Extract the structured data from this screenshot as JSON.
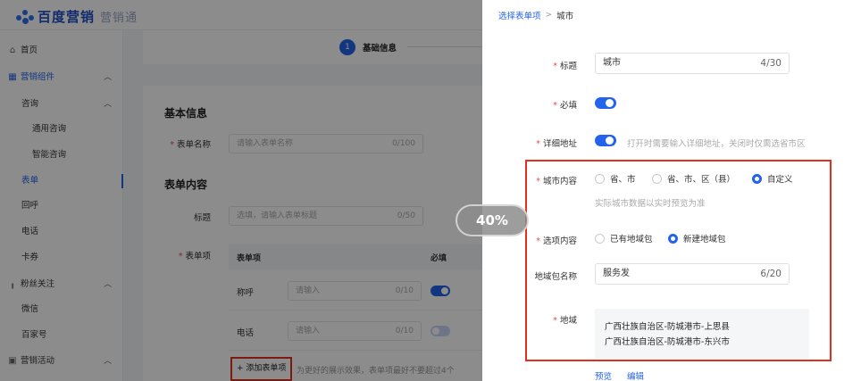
{
  "app": {
    "logo_main": "百度营销",
    "logo_sub": "营销通"
  },
  "sidebar": {
    "items": [
      {
        "label": "首页",
        "icon": "home-icon"
      },
      {
        "label": "营销组件",
        "icon": "grid-icon"
      },
      {
        "label": "咨询"
      },
      {
        "label": "通用咨询"
      },
      {
        "label": "智能咨询"
      },
      {
        "label": "表单"
      },
      {
        "label": "回呼"
      },
      {
        "label": "电话"
      },
      {
        "label": "卡券"
      },
      {
        "label": "粉丝关注",
        "icon": "bar-chart-icon"
      },
      {
        "label": "微信"
      },
      {
        "label": "百家号"
      },
      {
        "label": "营销活动",
        "icon": "calendar-icon"
      }
    ]
  },
  "steps": {
    "num": "1",
    "label": "基础信息"
  },
  "form": {
    "basic_title": "基本信息",
    "name_label": "表单名称",
    "name_placeholder": "请输入表单名称",
    "name_count": "0/100",
    "content_title": "表单内容",
    "heading_label": "标题",
    "heading_placeholder": "选填，请输入表单标题",
    "heading_count": "0/50",
    "items_label": "表单项",
    "table_head_item": "表单项",
    "table_head_required": "必填",
    "rows": [
      {
        "name": "称呼",
        "placeholder": "请输入",
        "count": "0/10",
        "required": true
      },
      {
        "name": "电话",
        "placeholder": "请输入",
        "count": "0/10",
        "required": false
      }
    ],
    "add_button": "+ 添加表单项",
    "add_hint": "为更好的展示效果，表单项最好不要超过4个"
  },
  "zoom_badge": "40%",
  "drawer": {
    "crumb_parent": "选择表单项",
    "crumb_sep": ">",
    "crumb_current": "城市",
    "title_label": "标题",
    "title_value": "城市",
    "title_count": "4/30",
    "required_label": "必填",
    "required_on": true,
    "address_label": "详细地址",
    "address_on": true,
    "address_hint": "打开时需要输入详细地址，关闭时仅需选省市区",
    "city_content_label": "城市内容",
    "city_options": [
      "省、市",
      "省、市、区（县）",
      "自定义"
    ],
    "city_selected": "自定义",
    "city_hint": "实际城市数据以实时预览为准",
    "option_content_label": "选项内容",
    "option_options": [
      "已有地域包",
      "新建地域包"
    ],
    "option_selected": "新建地域包",
    "pack_name_label": "地域包名称",
    "pack_name_value": "服务发",
    "pack_name_count": "6/20",
    "region_label": "地域",
    "regions": [
      "广西壮族自治区-防城港市-上思县",
      "广西壮族自治区-防城港市-东兴市"
    ],
    "preview_link": "预览",
    "edit_link": "编辑"
  },
  "colors": {
    "accent": "#2463eb",
    "highlight_box": "#e0301e",
    "required_star": "#e34d4d"
  }
}
